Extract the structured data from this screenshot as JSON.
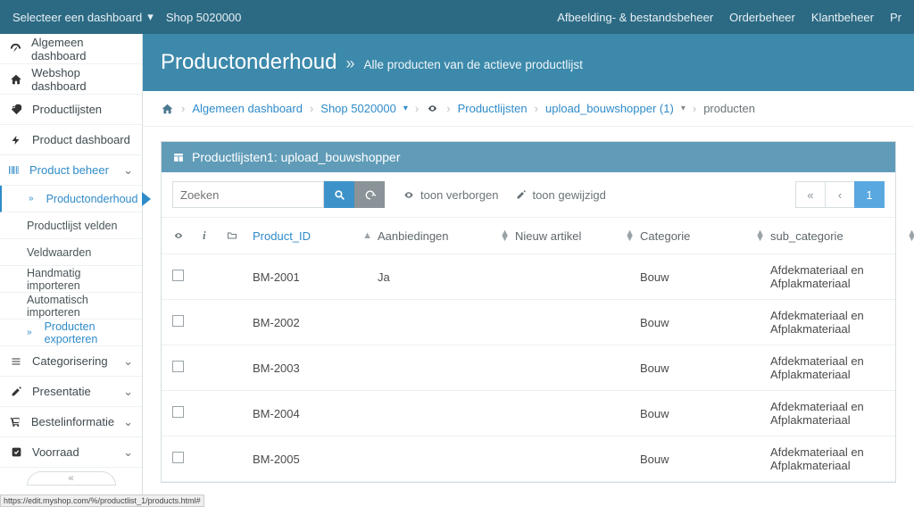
{
  "topbar": {
    "dashboard_selector": "Selecteer een dashboard",
    "shop_label": "Shop  5020000",
    "links": {
      "media": "Afbeelding- & bestandsbeheer",
      "orders": "Orderbeheer",
      "customers": "Klantbeheer",
      "products_cut": "Pr"
    }
  },
  "sidebar": {
    "general": "Algemeen dashboard",
    "webshop": "Webshop dashboard",
    "productlists": "Productlijsten",
    "productdash": "Product dashboard",
    "productmgr": "Product beheer",
    "sub": {
      "maintenance": "Productonderhoud",
      "fields": "Productlijst velden",
      "values": "Veldwaarden",
      "manual": "Handmatig importeren",
      "auto": "Automatisch importeren",
      "export": "Producten exporteren"
    },
    "categorising": "Categorisering",
    "presentation": "Presentatie",
    "orderinfo": "Bestelinformatie",
    "stock": "Voorraad"
  },
  "page": {
    "title": "Productonderhoud",
    "subtitle": "Alle producten van de actieve productlijst"
  },
  "breadcrumbs": {
    "general": "Algemeen dashboard",
    "shop": "Shop 5020000",
    "lists": "Productlijsten",
    "upload": "upload_bouwshopper (1)",
    "products": "producten"
  },
  "panel": {
    "title": "Productlijsten1: upload_bouwshopper",
    "search_placeholder": "Zoeken",
    "show_hidden": "toon verborgen",
    "show_changed": "toon gewijzigd",
    "page_1": "1"
  },
  "table": {
    "columns": {
      "product_id": "Product_ID",
      "offers": "Aanbiedingen",
      "new": "Nieuw artikel",
      "category": "Categorie",
      "subcategory": "sub_categorie"
    },
    "rows": [
      {
        "pid": "BM-2001",
        "offers": "Ja",
        "new": "",
        "cat": "Bouw",
        "sub": "Afdekmateriaal en Afplakmateriaal"
      },
      {
        "pid": "BM-2002",
        "offers": "",
        "new": "",
        "cat": "Bouw",
        "sub": "Afdekmateriaal en Afplakmateriaal"
      },
      {
        "pid": "BM-2003",
        "offers": "",
        "new": "",
        "cat": "Bouw",
        "sub": "Afdekmateriaal en Afplakmateriaal"
      },
      {
        "pid": "BM-2004",
        "offers": "",
        "new": "",
        "cat": "Bouw",
        "sub": "Afdekmateriaal en Afplakmateriaal"
      },
      {
        "pid": "BM-2005",
        "offers": "",
        "new": "",
        "cat": "Bouw",
        "sub": "Afdekmateriaal en Afplakmateriaal"
      }
    ]
  },
  "statusbar": "https://edit.myshop.com/%/productlist_1/products.html#"
}
